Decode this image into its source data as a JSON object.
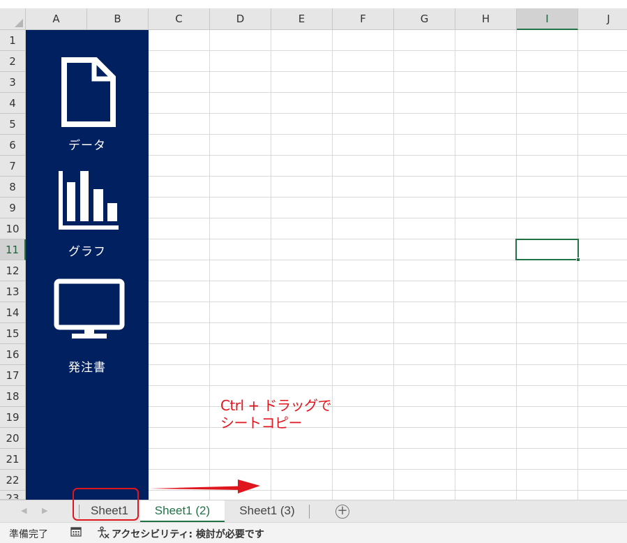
{
  "columns": [
    "A",
    "B",
    "C",
    "D",
    "E",
    "F",
    "G",
    "H",
    "I",
    "J"
  ],
  "active_column": "I",
  "rows": [
    "1",
    "2",
    "3",
    "4",
    "5",
    "6",
    "7",
    "8",
    "9",
    "10",
    "11",
    "12",
    "13",
    "14",
    "15",
    "16",
    "17",
    "18",
    "19",
    "20",
    "21",
    "22",
    "23"
  ],
  "active_row": "11",
  "panel": {
    "background": "#002060",
    "items": [
      {
        "icon": "document-icon",
        "label": "データ"
      },
      {
        "icon": "bar-chart-icon",
        "label": "グラフ"
      },
      {
        "icon": "monitor-icon",
        "label": "発注書"
      }
    ]
  },
  "annotation": {
    "line1": "Ctrl + ドラッグで",
    "line2": "シートコピー",
    "color": "#e0161f"
  },
  "sheet_tabs": [
    {
      "label": "Sheet1",
      "active": false
    },
    {
      "label": "Sheet1 (2)",
      "active": true
    },
    {
      "label": "Sheet1 (3)",
      "active": false
    }
  ],
  "add_sheet_label": "+",
  "status": {
    "ready": "準備完了",
    "accessibility": "アクセシビリティ: 検討が必要です"
  },
  "colors": {
    "accent": "#217346",
    "highlight": "#e0161f"
  }
}
